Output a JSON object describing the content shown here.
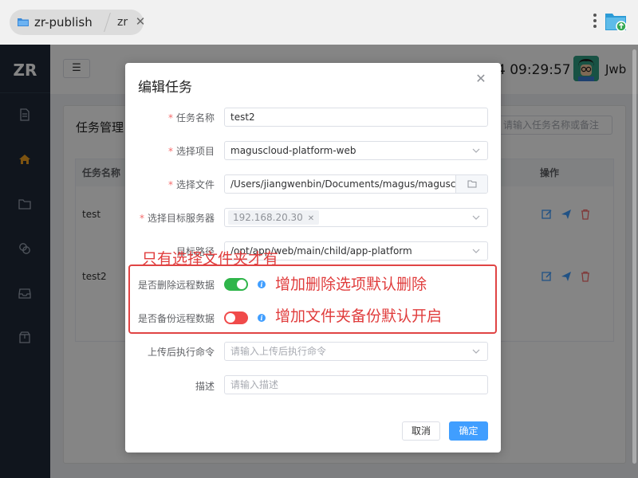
{
  "browser": {
    "tab_main": "zr-publish",
    "tab_sub": "zr"
  },
  "sidebar": {
    "logo": "ZR",
    "icons": [
      "document-icon",
      "home-icon",
      "folder-icon",
      "link-icon",
      "inbox-icon",
      "package-icon"
    ]
  },
  "header": {
    "clock": "4 09:29:57",
    "username": "Jwb"
  },
  "page": {
    "title": "任务管理",
    "search_placeholder": "请输入任务名称或备注",
    "table": {
      "columns": {
        "name": "任务名称",
        "actions": "操作"
      },
      "rows": [
        {
          "name": "test"
        },
        {
          "name": "test2"
        }
      ]
    }
  },
  "dialog": {
    "title": "编辑任务",
    "fields": {
      "task_name": {
        "label": "任务名称",
        "value": "test2",
        "required": true
      },
      "project": {
        "label": "选择项目",
        "value": "maguscloud-platform-web",
        "required": true
      },
      "file": {
        "label": "选择文件",
        "value": "/Users/jiangwenbin/Documents/magus/maguscloud",
        "required": true
      },
      "server": {
        "label": "选择目标服务器",
        "tag": "192.168.20.30",
        "required": true
      },
      "target_dir": {
        "label": "目标路径",
        "value": "/opt/app/web/main/child/app-platform"
      },
      "delete_remote": {
        "label": "是否删除远程数据",
        "on": true
      },
      "backup_remote": {
        "label": "是否备份远程数据",
        "on": false
      },
      "post_cmd": {
        "label": "上传后执行命令",
        "placeholder": "请输入上传后执行命令"
      },
      "desc": {
        "label": "描述",
        "placeholder": "请输入描述"
      }
    },
    "buttons": {
      "cancel": "取消",
      "ok": "确定"
    }
  },
  "annotations": {
    "folder_only": "只有选择文件夹才有",
    "delete_note": "增加删除选项默认删除",
    "backup_note": "增加文件夹备份默认开启"
  },
  "colors": {
    "switch_on": "#2fb54a",
    "switch_off": "#f04a4a",
    "primary": "#409eff",
    "annotation": "#e03c3c",
    "sidebar_bg": "#1f2a38"
  }
}
